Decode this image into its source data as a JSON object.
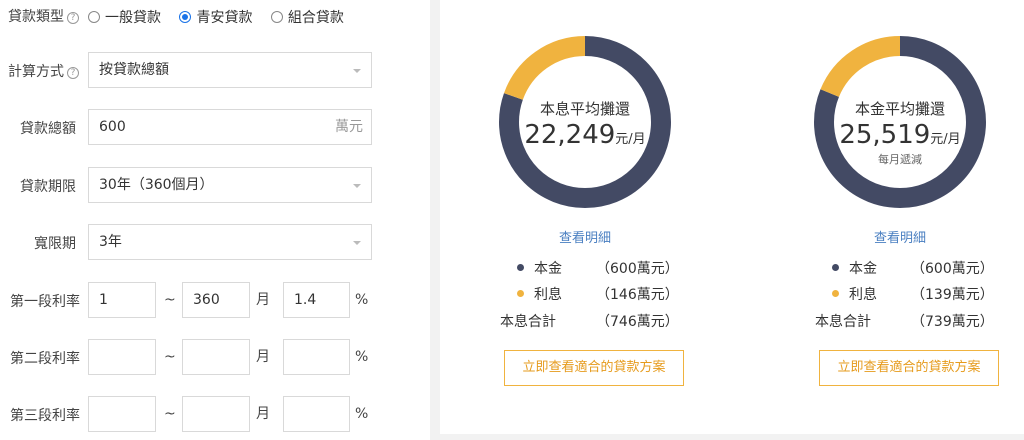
{
  "form": {
    "loan_type": {
      "label": "貸款類型",
      "options": [
        "一般貸款",
        "青安貸款",
        "組合貸款"
      ],
      "selected": 1
    },
    "calc_method": {
      "label": "計算方式",
      "value": "按貸款總額"
    },
    "loan_total": {
      "label": "貸款總額",
      "value": "600",
      "unit": "萬元"
    },
    "loan_term": {
      "label": "貸款期限",
      "value": "30年（360個月）"
    },
    "grace": {
      "label": "寬限期",
      "value": "3年"
    },
    "rate1": {
      "label": "第一段利率",
      "from": "1",
      "to": "360",
      "month_unit": "月",
      "rate": "1.4",
      "pct": "%",
      "tilde": "~"
    },
    "rate2": {
      "label": "第二段利率",
      "from": "",
      "to": "",
      "month_unit": "月",
      "rate": "",
      "pct": "%",
      "tilde": "~"
    },
    "rate3": {
      "label": "第三段利率",
      "from": "",
      "to": "",
      "month_unit": "月",
      "rate": "",
      "pct": "%",
      "tilde": "~"
    }
  },
  "colors": {
    "principal": "#434a64",
    "interest": "#f0b33f"
  },
  "results": [
    {
      "title": "本息平均攤還",
      "amount": "22,249",
      "unit": "元/月",
      "note": "",
      "detail_link": "查看明細",
      "legend": [
        {
          "label": "本金",
          "value": "（600萬元）"
        },
        {
          "label": "利息",
          "value": "（146萬元）"
        },
        {
          "label": "本息合計",
          "value": "（746萬元）"
        }
      ],
      "cta": "立即查看適合的貸款方案"
    },
    {
      "title": "本金平均攤還",
      "amount": "25,519",
      "unit": "元/月",
      "note": "每月遞減",
      "detail_link": "查看明細",
      "legend": [
        {
          "label": "本金",
          "value": "（600萬元）"
        },
        {
          "label": "利息",
          "value": "（139萬元）"
        },
        {
          "label": "本息合計",
          "value": "（739萬元）"
        }
      ],
      "cta": "立即查看適合的貸款方案"
    }
  ],
  "chart_data": [
    {
      "type": "pie",
      "series": [
        {
          "values": [
            600,
            146
          ]
        }
      ]
    },
    {
      "type": "pie",
      "series": [
        {
          "values": [
            600,
            139
          ]
        }
      ]
    }
  ]
}
